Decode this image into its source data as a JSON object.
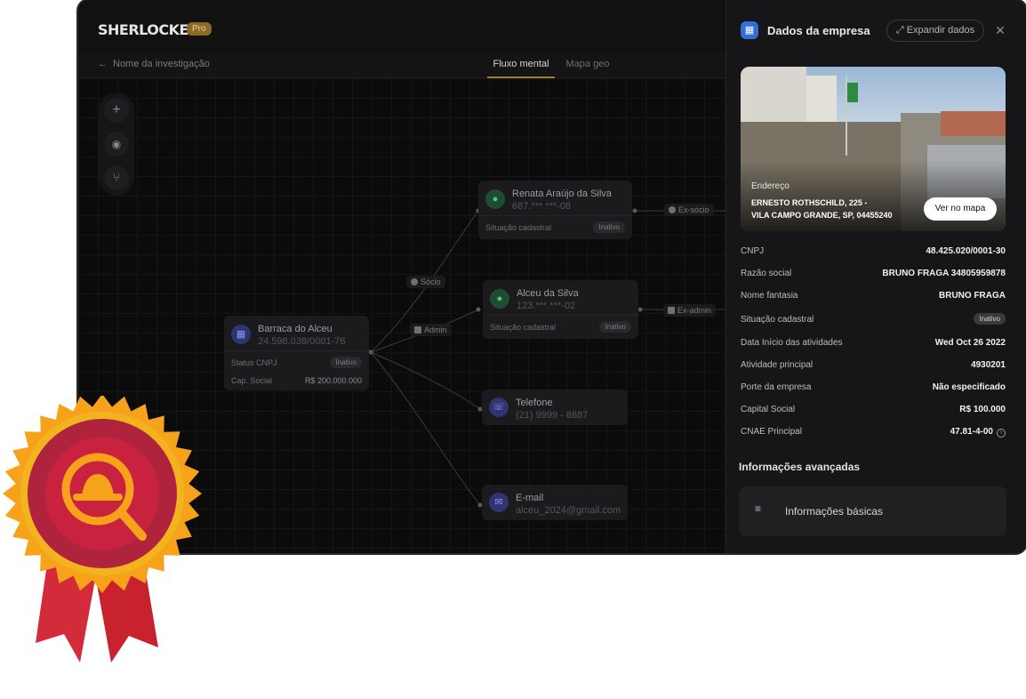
{
  "app": {
    "logo": "SHERLOCKER",
    "badge": "Pro",
    "back_label": "Nome da investigação",
    "tabs": [
      {
        "label": "Fluxo mental",
        "active": true
      },
      {
        "label": "Mapa geo",
        "active": false
      }
    ],
    "toolbar": [
      {
        "icon": "plus-icon",
        "glyph": "+"
      },
      {
        "icon": "eye-icon",
        "glyph": "◉"
      },
      {
        "icon": "tree-icon",
        "glyph": "⑂"
      }
    ]
  },
  "graph": {
    "company": {
      "name": "Barraca do Alceu",
      "cnpj": "24.598.038/0001-76",
      "status_label": "Status CNPJ",
      "status": "Inativo",
      "capital_label": "Cap. Social",
      "capital": "R$ 200.000.000"
    },
    "people": [
      {
        "name": "Renata Araújo da Silva",
        "doc": "687.***.***-08",
        "row_label": "Situação cadastral",
        "status": "Inativo"
      },
      {
        "name": "Alceu da Silva",
        "doc": "123.***.***-02",
        "row_label": "Situação cadastral",
        "status": "Inativo"
      }
    ],
    "contacts": [
      {
        "name": "Telefone",
        "value": "(21) 9999 - 8887"
      },
      {
        "name": "E-mail",
        "value": "alceu_2024@gmail.com"
      }
    ],
    "edges": {
      "socio": "Sócio",
      "admin": "Admin",
      "ex_socio": "Ex-sócio",
      "ex_admin": "Ex-admin"
    }
  },
  "panel": {
    "title": "Dados da empresa",
    "expand_label": "Expandir dados",
    "close_glyph": "✕",
    "address_label": "Endereço",
    "address_line1": "ERNESTO ROTHSCHILD, 225 -",
    "address_line2": "VILA CAMPO GRANDE, SP, 04455240",
    "map_button": "Ver no mapa",
    "fields": [
      {
        "label": "CNPJ",
        "value": "48.425.020/0001-30"
      },
      {
        "label": "Razão social",
        "value": "BRUNO FRAGA 34805959878"
      },
      {
        "label": "Nome fantasia",
        "value": "BRUNO FRAGA"
      },
      {
        "label": "Situação cadastral",
        "value": "Inativo"
      },
      {
        "label": "Data Início das atividades",
        "value": "Wed Oct 26 2022"
      },
      {
        "label": "Atividade principal",
        "value": "4930201"
      },
      {
        "label": "Porte da empresa",
        "value": "Não especificado"
      },
      {
        "label": "Capital Social",
        "value": "R$ 100.000"
      },
      {
        "label": "CNAE Principal",
        "value": "47.81-4-00"
      }
    ],
    "advanced_title": "Informações avançadas",
    "advanced_item": "Informações básicas"
  },
  "colors": {
    "accent": "#a07a30",
    "panel_icon": "#2f6fd6",
    "rosette_outer": "#f7a21b",
    "rosette_inner": "#b0233c",
    "ribbon": "#d42b3a"
  }
}
